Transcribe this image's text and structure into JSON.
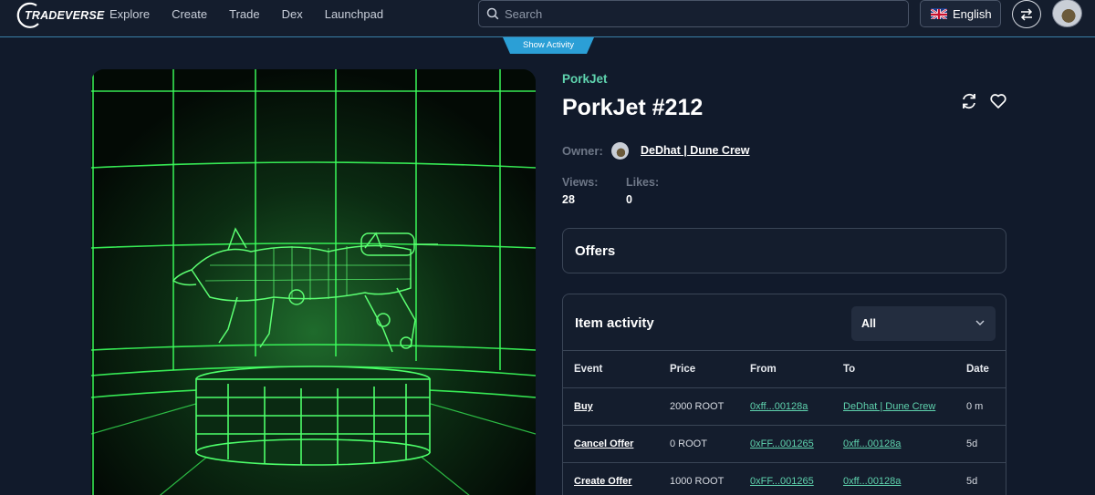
{
  "app": {
    "logo_text": "TRADEVERSE"
  },
  "nav": {
    "items": [
      {
        "label": "Explore"
      },
      {
        "label": "Create"
      },
      {
        "label": "Trade"
      },
      {
        "label": "Dex"
      },
      {
        "label": "Launchpad"
      }
    ]
  },
  "search": {
    "placeholder": "Search",
    "value": ""
  },
  "language": {
    "label": "English",
    "flag": "uk-flag-icon"
  },
  "show_activity": {
    "label": "Show Activity"
  },
  "item": {
    "collection": "PorkJet",
    "title": "PorkJet #212",
    "owner_label": "Owner:",
    "owner_name": "DeDhat | Dune Crew",
    "views_label": "Views:",
    "views_value": "28",
    "likes_label": "Likes:",
    "likes_value": "0"
  },
  "offers": {
    "title": "Offers"
  },
  "activity": {
    "title": "Item activity",
    "filter_value": "All",
    "columns": [
      "Event",
      "Price",
      "From",
      "To",
      "Date"
    ],
    "rows": [
      {
        "event": "Buy",
        "price": "2000 ROOT",
        "from": "0xff...00128a",
        "to": "DeDhat | Dune Crew",
        "date": "0 m"
      },
      {
        "event": "Cancel Offer",
        "price": "0 ROOT",
        "from": "0xFF...001265",
        "to": "0xff...00128a",
        "date": "5d"
      },
      {
        "event": "Create Offer",
        "price": "1000 ROOT",
        "from": "0xFF...001265",
        "to": "0xff...00128a",
        "date": "5d"
      }
    ]
  },
  "colors": {
    "background": "#111a2b",
    "accent_teal": "#5fd3ae",
    "accent_blue": "#2b9fd6",
    "image_glow": "#39ff5a"
  }
}
